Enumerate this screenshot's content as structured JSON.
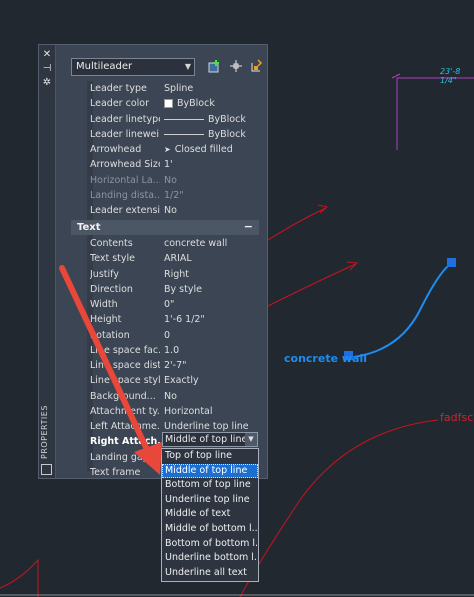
{
  "drawing": {
    "mleader_label": "concrete wall",
    "red_label": "fadfsc",
    "dim_label": "23'-8 1/4\"",
    "colors": {
      "background": "#212830",
      "blue": "#1e8cf0",
      "red": "#c8141e",
      "magenta": "#b040c0",
      "cyan": "#27c4e0",
      "arrow": "#e8473a"
    }
  },
  "palette": {
    "side_label": "PROPERTIES",
    "side_icons": [
      "close-icon",
      "pin-icon",
      "settings-icon"
    ],
    "object_type": "Multileader",
    "toolbar_icons": [
      "toggle-pickadd-icon",
      "select-objects-icon",
      "quick-select-icon"
    ],
    "leader_rows": [
      {
        "label": "Leader type",
        "value": "Spline"
      },
      {
        "label": "Leader color",
        "value": "ByBlock",
        "swatch": true
      },
      {
        "label": "Leader linetype",
        "value": "ByBlock",
        "line": true
      },
      {
        "label": "Leader linewei...",
        "value": "ByBlock",
        "line": true
      },
      {
        "label": "Arrowhead",
        "value": "Closed filled",
        "arrow": true
      },
      {
        "label": "Arrowhead Size",
        "value": "1'"
      },
      {
        "label": "Horizontal La...",
        "value": "No",
        "dim": true
      },
      {
        "label": "Landing dista...",
        "value": "1/2\"",
        "dim": true
      },
      {
        "label": "Leader extensi...",
        "value": "No"
      }
    ],
    "text_section": {
      "title": "Text",
      "collapse": "−"
    },
    "text_rows": [
      {
        "label": "Contents",
        "value": "concrete wall"
      },
      {
        "label": "Text style",
        "value": "ARIAL"
      },
      {
        "label": "Justify",
        "value": "Right"
      },
      {
        "label": "Direction",
        "value": "By style"
      },
      {
        "label": "Width",
        "value": "0\""
      },
      {
        "label": "Height",
        "value": "1'-6 1/2\""
      },
      {
        "label": "Rotation",
        "value": "0"
      },
      {
        "label": "Line space fac...",
        "value": "1.0"
      },
      {
        "label": "Line space dist...",
        "value": "2'-7\""
      },
      {
        "label": "Line space style",
        "value": "Exactly"
      },
      {
        "label": "Background...",
        "value": "No"
      },
      {
        "label": "Attachment ty...",
        "value": "Horizontal"
      },
      {
        "label": "Left Attachme...",
        "value": "Underline top line"
      },
      {
        "label": "Right Attach...",
        "value": "",
        "bold": true
      },
      {
        "label": "Landing gap",
        "value": ""
      },
      {
        "label": "Text frame",
        "value": ""
      }
    ],
    "right_attach_value": "Middle of top line",
    "dropdown_options": [
      "Top of top line",
      "Middle of top line",
      "Bottom of top line",
      "Underline top line",
      "Middle of text",
      "Middle of bottom l...",
      "Bottom of bottom l...",
      "Underline bottom l...",
      "Underline all text"
    ],
    "dropdown_selected_index": 1
  }
}
